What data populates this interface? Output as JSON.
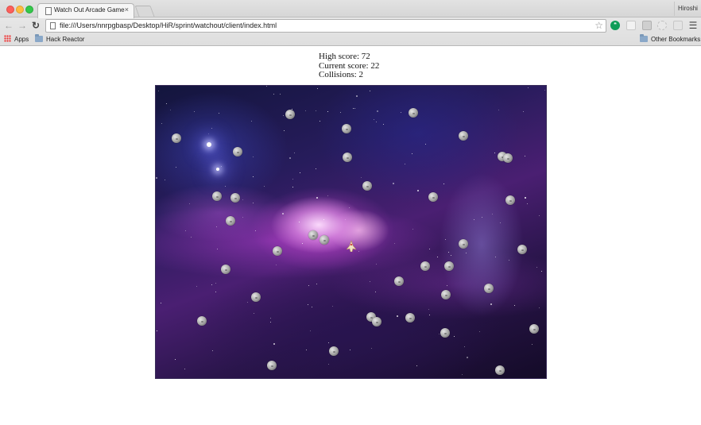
{
  "browser": {
    "tab_title": "Watch Out Arcade Game",
    "tab_close": "×",
    "profile_name": "Hiroshi",
    "url": "file:///Users/nnrpgbasp/Desktop/HiR/sprint/watchout/client/index.html",
    "bookmarks": {
      "apps_label": "Apps",
      "items": [
        "Hack Reactor"
      ],
      "other_label": "Other Bookmarks"
    },
    "icons": {
      "back": "arrow-left-icon",
      "forward": "arrow-right-icon",
      "reload": "reload-icon",
      "bookmark_star": "star-icon",
      "menu": "hamburger-icon"
    }
  },
  "game": {
    "high_score_label": "High score:",
    "high_score": "72",
    "current_score_label": "Current score:",
    "current_score": "22",
    "collisions_label": "Collisions:",
    "collisions": "2",
    "asteroid_count": 36,
    "colors": {
      "nebula_purple": "#a03cc8",
      "space_dark": "#140b28",
      "asteroid": "#a9a9a9"
    }
  }
}
